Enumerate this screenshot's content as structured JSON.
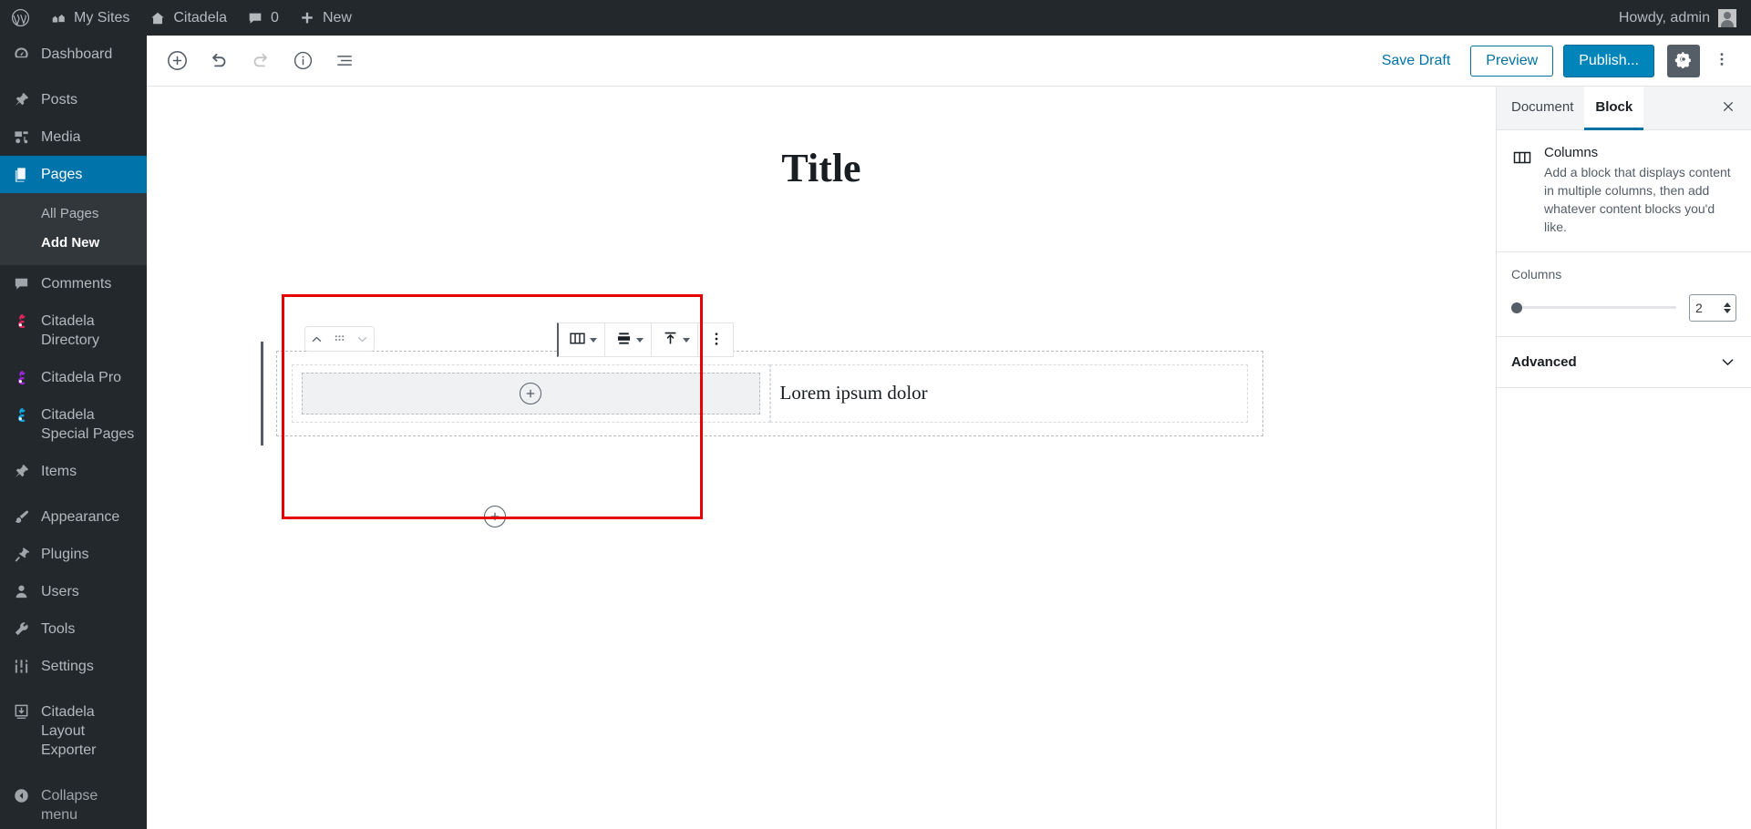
{
  "adminbar": {
    "wp_logo": "wordpress-logo-icon",
    "items": [
      {
        "label": "My Sites",
        "icon": "my-sites-icon"
      },
      {
        "label": "Citadela",
        "icon": "home-icon"
      },
      {
        "label": "0",
        "icon": "comment-bubble-icon"
      },
      {
        "label": "New",
        "icon": "plus-icon"
      }
    ],
    "howdy": "Howdy, admin",
    "avatar": "user-avatar"
  },
  "sidebar": {
    "items": [
      {
        "label": "Dashboard",
        "icon": "dashboard-icon",
        "current": false
      },
      {
        "label": "Posts",
        "icon": "pin-icon",
        "current": false
      },
      {
        "label": "Media",
        "icon": "media-icon",
        "current": false
      },
      {
        "label": "Pages",
        "icon": "pages-icon",
        "current": true
      },
      {
        "label": "Comments",
        "icon": "comment-icon",
        "current": false
      },
      {
        "label": "Citadela Directory",
        "icon": "citadela-logo-pink-icon",
        "current": false
      },
      {
        "label": "Citadela Pro",
        "icon": "citadela-logo-purple-icon",
        "current": false
      },
      {
        "label": "Citadela Special Pages",
        "icon": "citadela-logo-cyan-icon",
        "current": false
      },
      {
        "label": "Items",
        "icon": "pin-icon",
        "current": false
      },
      {
        "label": "Appearance",
        "icon": "brush-icon",
        "current": false
      },
      {
        "label": "Plugins",
        "icon": "plug-icon",
        "current": false
      },
      {
        "label": "Users",
        "icon": "user-icon",
        "current": false
      },
      {
        "label": "Tools",
        "icon": "wrench-icon",
        "current": false
      },
      {
        "label": "Settings",
        "icon": "sliders-icon",
        "current": false
      },
      {
        "label": "Citadela Layout Exporter",
        "icon": "export-icon",
        "current": false
      }
    ],
    "submenu": [
      {
        "label": "All Pages",
        "current": false
      },
      {
        "label": "Add New",
        "current": true
      }
    ],
    "collapse": {
      "label": "Collapse menu",
      "icon": "collapse-arrow-icon"
    }
  },
  "editor_header": {
    "tools": [
      {
        "name": "add-block-button",
        "icon": "plus-circle-icon",
        "disabled": false
      },
      {
        "name": "undo-button",
        "icon": "undo-icon",
        "disabled": false
      },
      {
        "name": "redo-button",
        "icon": "redo-icon",
        "disabled": true
      },
      {
        "name": "content-info-button",
        "icon": "info-circle-icon",
        "disabled": false
      },
      {
        "name": "block-navigation-button",
        "icon": "list-view-icon",
        "disabled": false
      }
    ],
    "save_draft": "Save Draft",
    "preview": "Preview",
    "publish": "Publish...",
    "settings_icon": "gear-icon",
    "more_icon": "kebab-menu-icon"
  },
  "canvas": {
    "title": "Title",
    "mover": {
      "up_icon": "chevron-up-icon",
      "drag_icon": "drag-handle-icon",
      "down_icon": "chevron-down-icon"
    },
    "block_toolbar": [
      {
        "name": "block-type-columns-button",
        "icon": "columns-icon"
      },
      {
        "name": "change-alignment-button",
        "icon": "align-icon"
      },
      {
        "name": "vertical-align-button",
        "icon": "vertical-align-top-icon"
      },
      {
        "name": "block-more-options-button",
        "icon": "kebab-menu-icon"
      }
    ],
    "columns": [
      {
        "type": "appender",
        "appender_icon": "plus-circle-icon"
      },
      {
        "type": "text",
        "text": "Lorem ipsum dolor"
      }
    ],
    "bottom_appender_icon": "plus-circle-icon",
    "annotation_color": "#e60000"
  },
  "settings_sidebar": {
    "tabs": [
      {
        "label": "Document",
        "active": false
      },
      {
        "label": "Block",
        "active": true
      }
    ],
    "close_icon": "close-icon",
    "block_card": {
      "icon": "columns-icon",
      "title": "Columns",
      "description": "Add a block that displays content in multiple columns, then add whatever content blocks you'd like."
    },
    "columns_panel": {
      "label": "Columns",
      "value": "2",
      "slider_position_percent": 0
    },
    "advanced": {
      "label": "Advanced",
      "icon": "chevron-down-icon"
    }
  },
  "colors": {
    "admin_dark": "#23282d",
    "admin_highlight": "#0073aa",
    "publish_blue": "#0085ba",
    "annotation_red": "#e60000"
  }
}
